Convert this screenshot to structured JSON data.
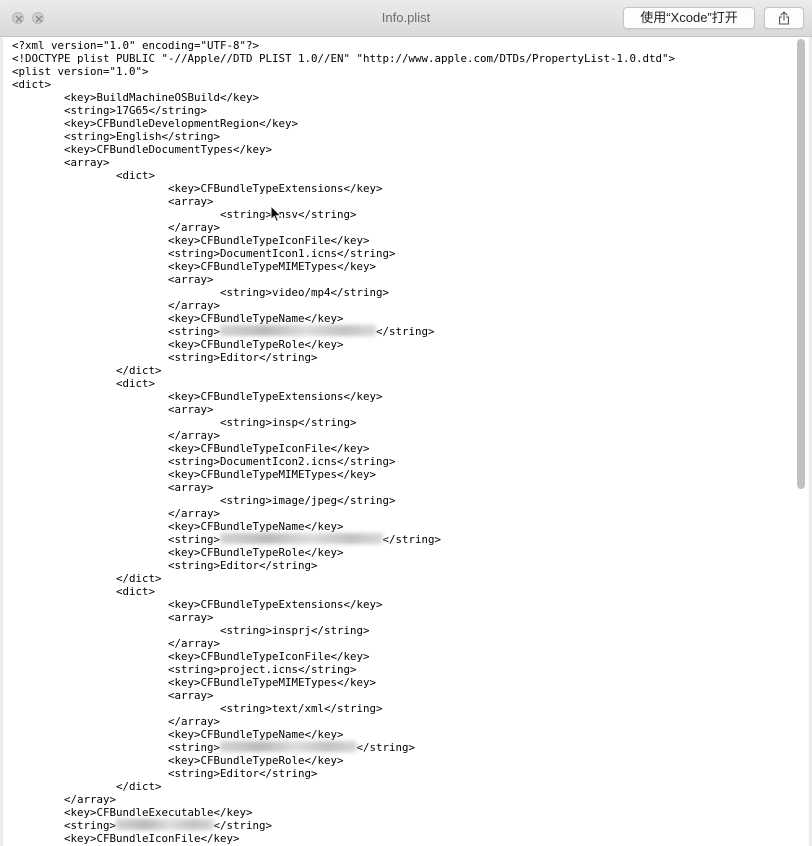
{
  "window": {
    "title": "Info.plist",
    "open_with_button": "使用“Xcode”打开"
  },
  "code_lines": [
    {
      "indent": "",
      "text": "<?xml version=\"1.0\" encoding=\"UTF-8\"?>"
    },
    {
      "indent": "",
      "text": "<!DOCTYPE plist PUBLIC \"-//Apple//DTD PLIST 1.0//EN\" \"http://www.apple.com/DTDs/PropertyList-1.0.dtd\">"
    },
    {
      "indent": "",
      "text": "<plist version=\"1.0\">"
    },
    {
      "indent": "",
      "text": "<dict>"
    },
    {
      "indent": "\t",
      "text": "<key>BuildMachineOSBuild</key>"
    },
    {
      "indent": "\t",
      "text": "<string>17G65</string>"
    },
    {
      "indent": "\t",
      "text": "<key>CFBundleDevelopmentRegion</key>"
    },
    {
      "indent": "\t",
      "text": "<string>English</string>"
    },
    {
      "indent": "\t",
      "text": "<key>CFBundleDocumentTypes</key>"
    },
    {
      "indent": "\t",
      "text": "<array>"
    },
    {
      "indent": "\t\t",
      "text": "<dict>"
    },
    {
      "indent": "\t\t\t",
      "text": "<key>CFBundleTypeExtensions</key>"
    },
    {
      "indent": "\t\t\t",
      "text": "<array>"
    },
    {
      "indent": "\t\t\t\t",
      "text": "<string>insv</string>"
    },
    {
      "indent": "\t\t\t",
      "text": "</array>"
    },
    {
      "indent": "\t\t\t",
      "text": "<key>CFBundleTypeIconFile</key>"
    },
    {
      "indent": "\t\t\t",
      "text": "<string>DocumentIcon1.icns</string>"
    },
    {
      "indent": "\t\t\t",
      "text": "<key>CFBundleTypeMIMETypes</key>"
    },
    {
      "indent": "\t\t\t",
      "text": "<array>"
    },
    {
      "indent": "\t\t\t\t",
      "text": "<string>video/mp4</string>"
    },
    {
      "indent": "\t\t\t",
      "text": "</array>"
    },
    {
      "indent": "\t\t\t",
      "text": "<key>CFBundleTypeName</key>"
    },
    {
      "indent": "\t\t\t",
      "pre": "<string>",
      "blur_chars": 24,
      "post": "</string>"
    },
    {
      "indent": "\t\t\t",
      "text": "<key>CFBundleTypeRole</key>"
    },
    {
      "indent": "\t\t\t",
      "text": "<string>Editor</string>"
    },
    {
      "indent": "\t\t",
      "text": "</dict>"
    },
    {
      "indent": "\t\t",
      "text": "<dict>"
    },
    {
      "indent": "\t\t\t",
      "text": "<key>CFBundleTypeExtensions</key>"
    },
    {
      "indent": "\t\t\t",
      "text": "<array>"
    },
    {
      "indent": "\t\t\t\t",
      "text": "<string>insp</string>"
    },
    {
      "indent": "\t\t\t",
      "text": "</array>"
    },
    {
      "indent": "\t\t\t",
      "text": "<key>CFBundleTypeIconFile</key>"
    },
    {
      "indent": "\t\t\t",
      "text": "<string>DocumentIcon2.icns</string>"
    },
    {
      "indent": "\t\t\t",
      "text": "<key>CFBundleTypeMIMETypes</key>"
    },
    {
      "indent": "\t\t\t",
      "text": "<array>"
    },
    {
      "indent": "\t\t\t\t",
      "text": "<string>image/jpeg</string>"
    },
    {
      "indent": "\t\t\t",
      "text": "</array>"
    },
    {
      "indent": "\t\t\t",
      "text": "<key>CFBundleTypeName</key>"
    },
    {
      "indent": "\t\t\t",
      "pre": "<string>",
      "blur_chars": 25,
      "post": "</string>"
    },
    {
      "indent": "\t\t\t",
      "text": "<key>CFBundleTypeRole</key>"
    },
    {
      "indent": "\t\t\t",
      "text": "<string>Editor</string>"
    },
    {
      "indent": "\t\t",
      "text": "</dict>"
    },
    {
      "indent": "\t\t",
      "text": "<dict>"
    },
    {
      "indent": "\t\t\t",
      "text": "<key>CFBundleTypeExtensions</key>"
    },
    {
      "indent": "\t\t\t",
      "text": "<array>"
    },
    {
      "indent": "\t\t\t\t",
      "text": "<string>insprj</string>"
    },
    {
      "indent": "\t\t\t",
      "text": "</array>"
    },
    {
      "indent": "\t\t\t",
      "text": "<key>CFBundleTypeIconFile</key>"
    },
    {
      "indent": "\t\t\t",
      "text": "<string>project.icns</string>"
    },
    {
      "indent": "\t\t\t",
      "text": "<key>CFBundleTypeMIMETypes</key>"
    },
    {
      "indent": "\t\t\t",
      "text": "<array>"
    },
    {
      "indent": "\t\t\t\t",
      "text": "<string>text/xml</string>"
    },
    {
      "indent": "\t\t\t",
      "text": "</array>"
    },
    {
      "indent": "\t\t\t",
      "text": "<key>CFBundleTypeName</key>"
    },
    {
      "indent": "\t\t\t",
      "pre": "<string>",
      "blur_chars": 21,
      "post": "</string>"
    },
    {
      "indent": "\t\t\t",
      "text": "<key>CFBundleTypeRole</key>"
    },
    {
      "indent": "\t\t\t",
      "text": "<string>Editor</string>"
    },
    {
      "indent": "\t\t",
      "text": "</dict>"
    },
    {
      "indent": "\t",
      "text": "</array>"
    },
    {
      "indent": "\t",
      "text": "<key>CFBundleExecutable</key>"
    },
    {
      "indent": "\t",
      "pre": "<string>",
      "blur_chars": 15,
      "post": "</string>"
    },
    {
      "indent": "\t",
      "text": "<key>CFBundleIconFile</key>"
    }
  ]
}
